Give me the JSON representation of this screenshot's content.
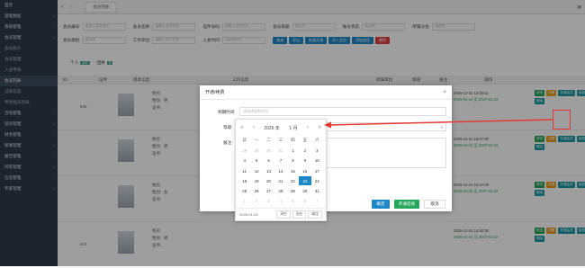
{
  "sidebar": {
    "items": [
      {
        "label": "首页",
        "type": "group",
        "caret": false
      },
      {
        "label": "基础数据",
        "type": "group",
        "caret": true
      },
      {
        "label": "系统管理",
        "type": "group",
        "caret": true
      },
      {
        "label": "会员管理",
        "type": "group",
        "caret": true
      },
      {
        "label": "会员统计",
        "type": "sub"
      },
      {
        "label": "会员管理",
        "type": "sub"
      },
      {
        "label": "入会申请",
        "type": "sub"
      },
      {
        "label": "会员列表",
        "type": "sub",
        "active": true
      },
      {
        "label": "证照信息",
        "type": "sub"
      },
      {
        "label": "申请会员列表",
        "type": "sub"
      },
      {
        "label": "活动管理",
        "type": "group",
        "caret": true
      },
      {
        "label": "培训管理",
        "type": "group",
        "caret": true
      },
      {
        "label": "财务管理",
        "type": "group",
        "caret": true
      },
      {
        "label": "新闻管理",
        "type": "group",
        "caret": true
      },
      {
        "label": "报告管理",
        "type": "group",
        "caret": true
      },
      {
        "label": "问卷管理",
        "type": "group",
        "caret": true
      },
      {
        "label": "信息管理",
        "type": "group",
        "caret": true
      },
      {
        "label": "专家管理",
        "type": "group",
        "caret": true
      }
    ]
  },
  "tabbar": {
    "tab_label": "会员列表",
    "collapse_icon": "»"
  },
  "filters": {
    "row1": [
      {
        "label": "会员编号:",
        "placeholder": "请输入会员编号"
      },
      {
        "label": "会员名称:",
        "placeholder": "请输入会员名称"
      },
      {
        "label": "证件号码:",
        "placeholder": "请输入证件号码"
      },
      {
        "label": "会员等级:",
        "placeholder": "请选择"
      },
      {
        "label": "账号状态:",
        "placeholder": "请选择"
      },
      {
        "label": "所属分会:",
        "placeholder": "请选择"
      }
    ],
    "row2": [
      {
        "label": "会员类别:",
        "placeholder": "请选择"
      },
      {
        "label": "工作单位:",
        "placeholder": "请输入单位名称"
      },
      {
        "label": "入会时间:",
        "placeholder": "请选择时间"
      }
    ],
    "buttons": [
      {
        "label": "查询",
        "color": "blue"
      },
      {
        "label": "导出",
        "color": "blue"
      },
      {
        "label": "批量开通",
        "color": "blue"
      },
      {
        "label": "导入会员",
        "color": "blue"
      },
      {
        "label": "添加会员",
        "color": "blue"
      },
      {
        "label": "删除",
        "color": "red"
      }
    ]
  },
  "counts": {
    "personal_label": "个人",
    "personal_count": "400",
    "group_label": "团体",
    "group_count": "0"
  },
  "table": {
    "headers": [
      "ID",
      "证件",
      "基本信息",
      "工作信息",
      "所属单位",
      "频道",
      "备注",
      "操作"
    ],
    "rows": [
      {
        "id": "600",
        "name_label": "姓名:",
        "gender_label": "性别:",
        "gender": "男",
        "cert_label": "证书:",
        "date1": "2025-12-31 13:39:41",
        "date2": "2025-01-22 至 2027-01-22"
      },
      {
        "id": "",
        "name_label": "姓名:",
        "gender_label": "性别:",
        "gender": "男",
        "cert_label": "证书:",
        "date1": "2025-12-31 16:07:09",
        "date2": "2025-01-22 至 2027-01-22"
      },
      {
        "id": "",
        "name_label": "姓名:",
        "gender_label": "性别:",
        "gender": "女",
        "cert_label": "证书:",
        "date1": "2025-12-24 16:10:09",
        "date2": "2025-01-22 至 2027-01-22"
      },
      {
        "id": "573",
        "name_label": "姓名:",
        "gender_label": "性别:",
        "gender": "男",
        "cert_label": "证书:",
        "date1": "2025-12-24 14:40:36",
        "date2": "2025-01-22 至 2027-01-22",
        "work_label": "工作单位:",
        "work": "空军军医大学第一附属医院",
        "dept_label": "备注:",
        "dept": "装通医院二十六团医学医学院",
        "unit": "文",
        "channel": "100"
      }
    ],
    "ops": [
      {
        "label": "修改",
        "color": "g"
      },
      {
        "label": "详情",
        "color": "o"
      },
      {
        "label": "开通会员",
        "color": "t"
      },
      {
        "label": "续费",
        "color": "t"
      },
      {
        "label": "删除",
        "color": "t"
      }
    ]
  },
  "dialog": {
    "title": "开通/续费",
    "close": "×",
    "fields": [
      {
        "label": "到期时间:",
        "placeholder": "请选择到期时间"
      },
      {
        "label": "等级:",
        "placeholder": ""
      },
      {
        "label": "备注:",
        "placeholder": ""
      }
    ],
    "buttons": {
      "confirm": "确定",
      "renew": "开通后续",
      "cancel": "取消"
    }
  },
  "calendar": {
    "year": "2026 年",
    "month": "1 月",
    "weekdays": [
      "日",
      "一",
      "二",
      "三",
      "四",
      "五",
      "六"
    ],
    "weeks": [
      [
        "28",
        "29",
        "30",
        "31",
        "1",
        "2",
        "3"
      ],
      [
        "4",
        "5",
        "6",
        "7",
        "8",
        "9",
        "10"
      ],
      [
        "11",
        "12",
        "13",
        "14",
        "15",
        "16",
        "17"
      ],
      [
        "18",
        "19",
        "20",
        "21",
        "22",
        "23",
        "24"
      ],
      [
        "25",
        "26",
        "27",
        "28",
        "29",
        "30",
        "31"
      ],
      [
        "1",
        "2",
        "3",
        "4",
        "5",
        "6",
        "7"
      ]
    ],
    "selected": "23",
    "footer_value": "2026-01-23",
    "footer_buttons": [
      "清空",
      "现在",
      "确定"
    ]
  },
  "colors": {
    "accent": "#1e88c7",
    "annotation": "#e53935",
    "sidebar": "#2f3b4a"
  }
}
